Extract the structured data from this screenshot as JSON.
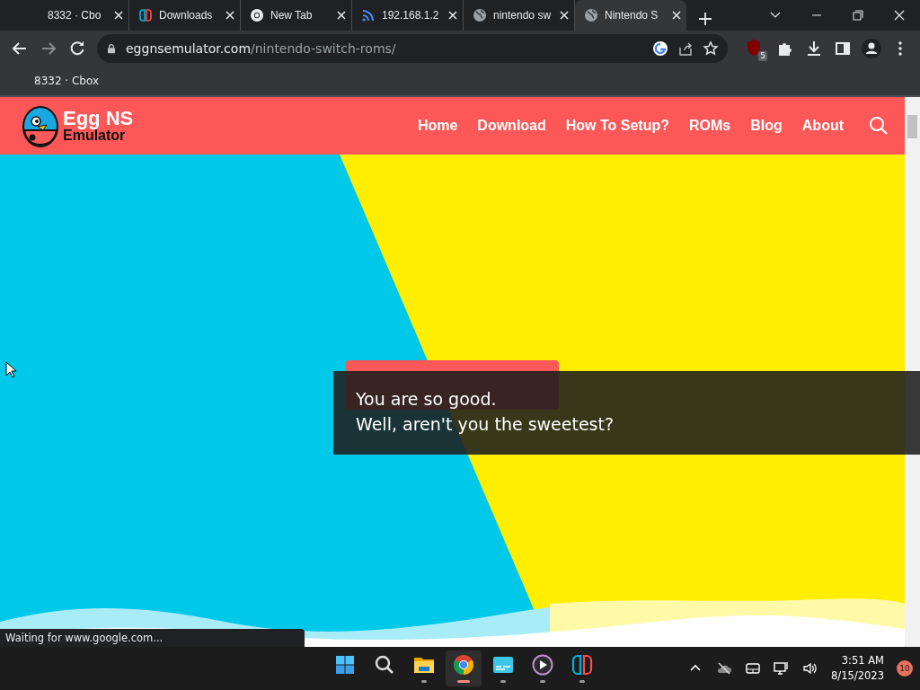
{
  "browser": {
    "tabs": [
      {
        "title": "8332 · Cbo",
        "kind": "plain",
        "selected": false
      },
      {
        "title": "Downloads",
        "kind": "switch",
        "selected": false
      },
      {
        "title": "New Tab",
        "kind": "chrome",
        "selected": false
      },
      {
        "title": "192.168.1.2",
        "kind": "wifi",
        "selected": false
      },
      {
        "title": "nintendo sw",
        "kind": "globe",
        "selected": false
      },
      {
        "title": "Nintendo S",
        "kind": "globe",
        "selected": true
      }
    ],
    "address": {
      "domain": "eggnsemulator.com",
      "path": "/nintendo-switch-roms/"
    },
    "extension_badge": "5",
    "bookmarks": [
      "8332 · Cbox"
    ],
    "status": "Waiting for www.google.com..."
  },
  "site": {
    "logo": {
      "line_1": "Egg NS",
      "line_2": "Emulator"
    },
    "nav": [
      "Home",
      "Download",
      "How To Setup?",
      "ROMs",
      "Blog",
      "About"
    ]
  },
  "caption": [
    "You are so good.",
    "Well, aren't you the sweetest?"
  ],
  "taskbar": {
    "apps": [
      {
        "kind": "start",
        "running": false,
        "selected": false
      },
      {
        "kind": "search",
        "running": false,
        "selected": false
      },
      {
        "kind": "folder",
        "running": true,
        "selected": false
      },
      {
        "kind": "chrome",
        "running": true,
        "selected": true
      },
      {
        "kind": "screen",
        "running": true,
        "selected": false
      },
      {
        "kind": "player",
        "running": true,
        "selected": false
      },
      {
        "kind": "switch",
        "running": true,
        "selected": false
      }
    ],
    "time": "3:51 AM",
    "date": "8/15/2023",
    "notifications": "10"
  }
}
